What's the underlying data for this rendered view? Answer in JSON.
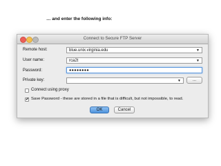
{
  "caption": "… and enter the following info:",
  "dialog": {
    "title": "Connect to Secure FTP Server",
    "remote_host_label": "Remote host:",
    "remote_host_value": "blue.unix.virginia.edu",
    "user_name_label": "User name:",
    "user_name_value": "rca2t",
    "password_label": "Password:",
    "password_value": "●●●●●●●●",
    "private_key_label": "Private key:",
    "private_key_value": "",
    "browse_button": "...",
    "use_proxy_label": "Connect using proxy",
    "use_proxy_checked": false,
    "save_password_label": "Save Password - these are stored in a file that is difficult, but not impossible, to read.",
    "save_password_checked": true,
    "ok_button": "OK",
    "cancel_button": "Cancel",
    "dropdown_arrow": "▼",
    "checkmark": "✔"
  }
}
